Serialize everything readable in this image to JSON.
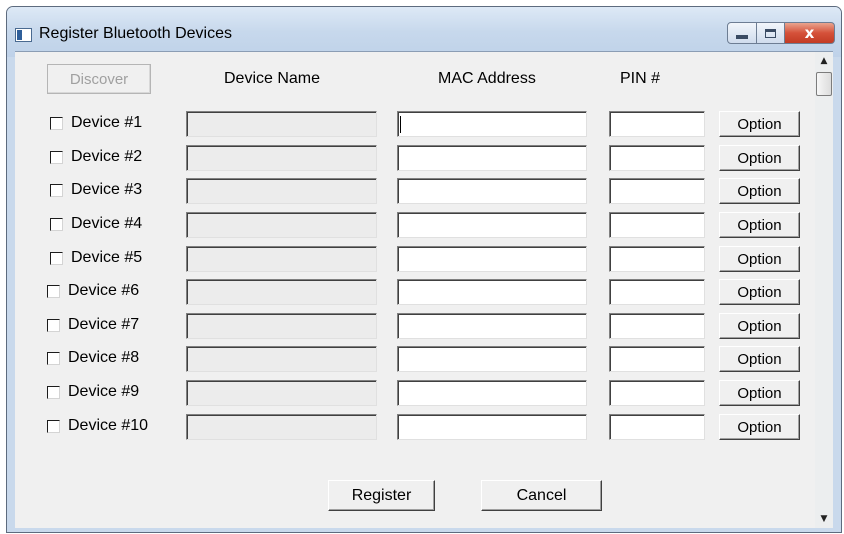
{
  "window": {
    "title": "Register Bluetooth Devices",
    "close_glyph": "x"
  },
  "toolbar": {
    "discover_label": "Discover"
  },
  "columns": {
    "device_name": "Device Name",
    "mac_address": "MAC Address",
    "pin": "PIN #"
  },
  "devices": [
    {
      "label": "Device #1",
      "name": "",
      "mac": "",
      "pin": "",
      "option_label": "Option"
    },
    {
      "label": "Device #2",
      "name": "",
      "mac": "",
      "pin": "",
      "option_label": "Option"
    },
    {
      "label": "Device #3",
      "name": "",
      "mac": "",
      "pin": "",
      "option_label": "Option"
    },
    {
      "label": "Device #4",
      "name": "",
      "mac": "",
      "pin": "",
      "option_label": "Option"
    },
    {
      "label": "Device #5",
      "name": "",
      "mac": "",
      "pin": "",
      "option_label": "Option"
    },
    {
      "label": "Device #6",
      "name": "",
      "mac": "",
      "pin": "",
      "option_label": "Option"
    },
    {
      "label": "Device #7",
      "name": "",
      "mac": "",
      "pin": "",
      "option_label": "Option"
    },
    {
      "label": "Device #8",
      "name": "",
      "mac": "",
      "pin": "",
      "option_label": "Option"
    },
    {
      "label": "Device #9",
      "name": "",
      "mac": "",
      "pin": "",
      "option_label": "Option"
    },
    {
      "label": "Device #10",
      "name": "",
      "mac": "",
      "pin": "",
      "option_label": "Option"
    }
  ],
  "footer": {
    "register_label": "Register",
    "cancel_label": "Cancel"
  },
  "scrollbar": {
    "up_glyph": "▲",
    "down_glyph": "▼"
  }
}
